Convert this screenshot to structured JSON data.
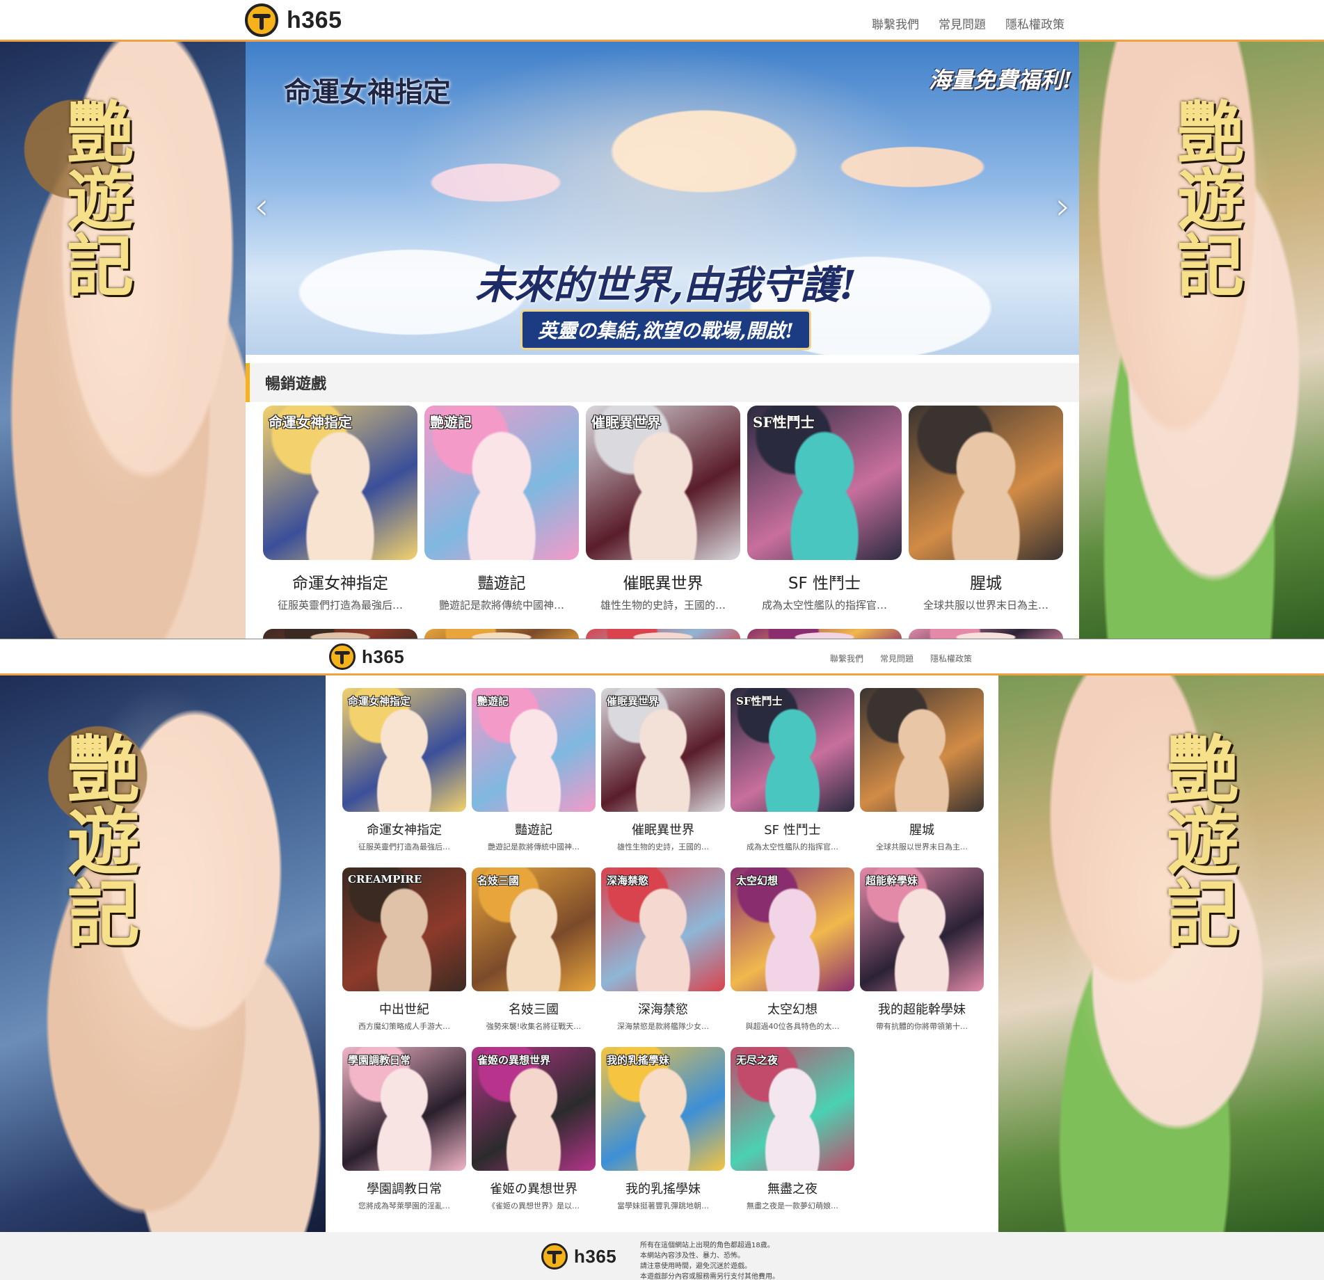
{
  "site": {
    "logo_text": "h365",
    "nav": [
      "聯繫我們",
      "常見問題",
      "隱私權政策"
    ]
  },
  "side_art": {
    "title": "艷遊記"
  },
  "banner": {
    "game_logo": "命運女神指定",
    "tagline": "海量免費福利!",
    "headline": "未來的世界,由我守護!",
    "subline": "英靈の集結,欲望の戰場,開啟!"
  },
  "section": {
    "title": "暢銷遊戲"
  },
  "games": [
    {
      "title": "命運女神指定",
      "desc": "征服英靈們打造為最強后…",
      "thumb_label": "命運女神指定",
      "palette": [
        "#f3d26d",
        "#3b4f9a",
        "#f7e3cf"
      ]
    },
    {
      "title": "豔遊記",
      "desc": "艷遊記是款將傳統中國神…",
      "thumb_label": "艷遊記",
      "palette": [
        "#f49ac8",
        "#7fb8e0",
        "#fbe4e8"
      ]
    },
    {
      "title": "催眠異世界",
      "desc": "雄性生物的史詩，王國的…",
      "thumb_label": "催眠異世界",
      "palette": [
        "#d9d9de",
        "#5a1d2a",
        "#f3e0d6"
      ]
    },
    {
      "title": "SF 性鬥士",
      "desc": "成為太空性艦队的指挥官…",
      "thumb_label": "SF性鬥士",
      "palette": [
        "#2a2a3f",
        "#c86f9d",
        "#4ac6c0"
      ]
    },
    {
      "title": "腥城",
      "desc": "全球共服以世界末日為主…",
      "thumb_label": "",
      "palette": [
        "#3a3330",
        "#d18b46",
        "#e9c6a6"
      ]
    },
    {
      "title": "中出世紀",
      "desc": "西方魔幻策略成人手游大…",
      "thumb_label": "CREAMPIRE",
      "palette": [
        "#3b2a22",
        "#8c3a2a",
        "#e0c2a8"
      ]
    },
    {
      "title": "名妓三國",
      "desc": "強勢來襲!收集名將征戰天…",
      "thumb_label": "名妓三國",
      "palette": [
        "#e7a53c",
        "#7b4a2a",
        "#f4dcc0"
      ]
    },
    {
      "title": "深海禁慾",
      "desc": "深海禁慾是款將艦隊少女…",
      "thumb_label": "深海禁慾",
      "palette": [
        "#d9434d",
        "#8fb6d6",
        "#f5d9d0"
      ]
    },
    {
      "title": "太空幻想",
      "desc": "與超過40位各具特色的太…",
      "thumb_label": "太空幻想",
      "palette": [
        "#8a2d6f",
        "#f0b84d",
        "#f1d4e6"
      ]
    },
    {
      "title": "我的超能幹學妹",
      "desc": "帶有抗體的你將帶領第十…",
      "thumb_label": "超能幹學妹",
      "palette": [
        "#e38aa9",
        "#2b2236",
        "#f7e1dc"
      ]
    },
    {
      "title": "學園調教日常",
      "desc": "您將成為琴萊學園的淫亂…",
      "thumb_label": "學園調教日常",
      "palette": [
        "#f2b6c8",
        "#2a1f2c",
        "#f9e4e4"
      ]
    },
    {
      "title": "雀姬の異想世界",
      "desc": "《雀姬の異想世界》是以…",
      "thumb_label": "雀姬の異想世界",
      "palette": [
        "#b6348b",
        "#2b2b2b",
        "#f4d6cc"
      ]
    },
    {
      "title": "我的乳搖學妹",
      "desc": "當學妹挺著豐乳彈跳地朝…",
      "thumb_label": "我的乳搖學妹",
      "palette": [
        "#f5c542",
        "#3d8fd6",
        "#f7dcc8"
      ]
    },
    {
      "title": "無盡之夜",
      "desc": "無盡之夜是一款夢幻萌娘…",
      "thumb_label": "无尽之夜",
      "palette": [
        "#c24a6a",
        "#4bd1b2",
        "#f3e6ef"
      ]
    }
  ],
  "footer": {
    "notes": [
      "所有在這個網站上出現的角色都超過18歲。",
      "本網站內容涉及性、暴力、恐怖。",
      "請注意使用時間，避免沉迷於遊戲。",
      "本遊戲部分內容或服務需另行支付其他費用。"
    ]
  }
}
